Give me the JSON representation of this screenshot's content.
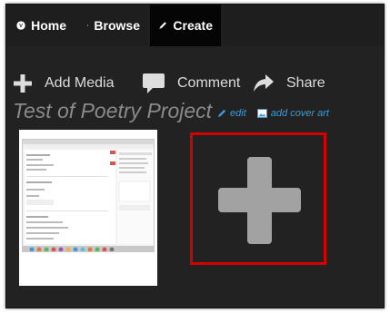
{
  "nav": {
    "items": [
      {
        "label": "Home",
        "icon": "site-logo-icon"
      },
      {
        "label": "Browse",
        "icon": "globe-icon"
      },
      {
        "label": "Create",
        "icon": "pencil-icon",
        "active": true
      }
    ]
  },
  "toolbar": {
    "add_media": "Add Media",
    "comment": "Comment",
    "share": "Share"
  },
  "project": {
    "title": "Test of Poetry Project",
    "edit_label": "edit",
    "cover_label": "add cover art"
  },
  "colors": {
    "background": "#222222",
    "link": "#3d9ad6",
    "highlight_border": "#d40000",
    "plus": "#a2a2a2"
  }
}
